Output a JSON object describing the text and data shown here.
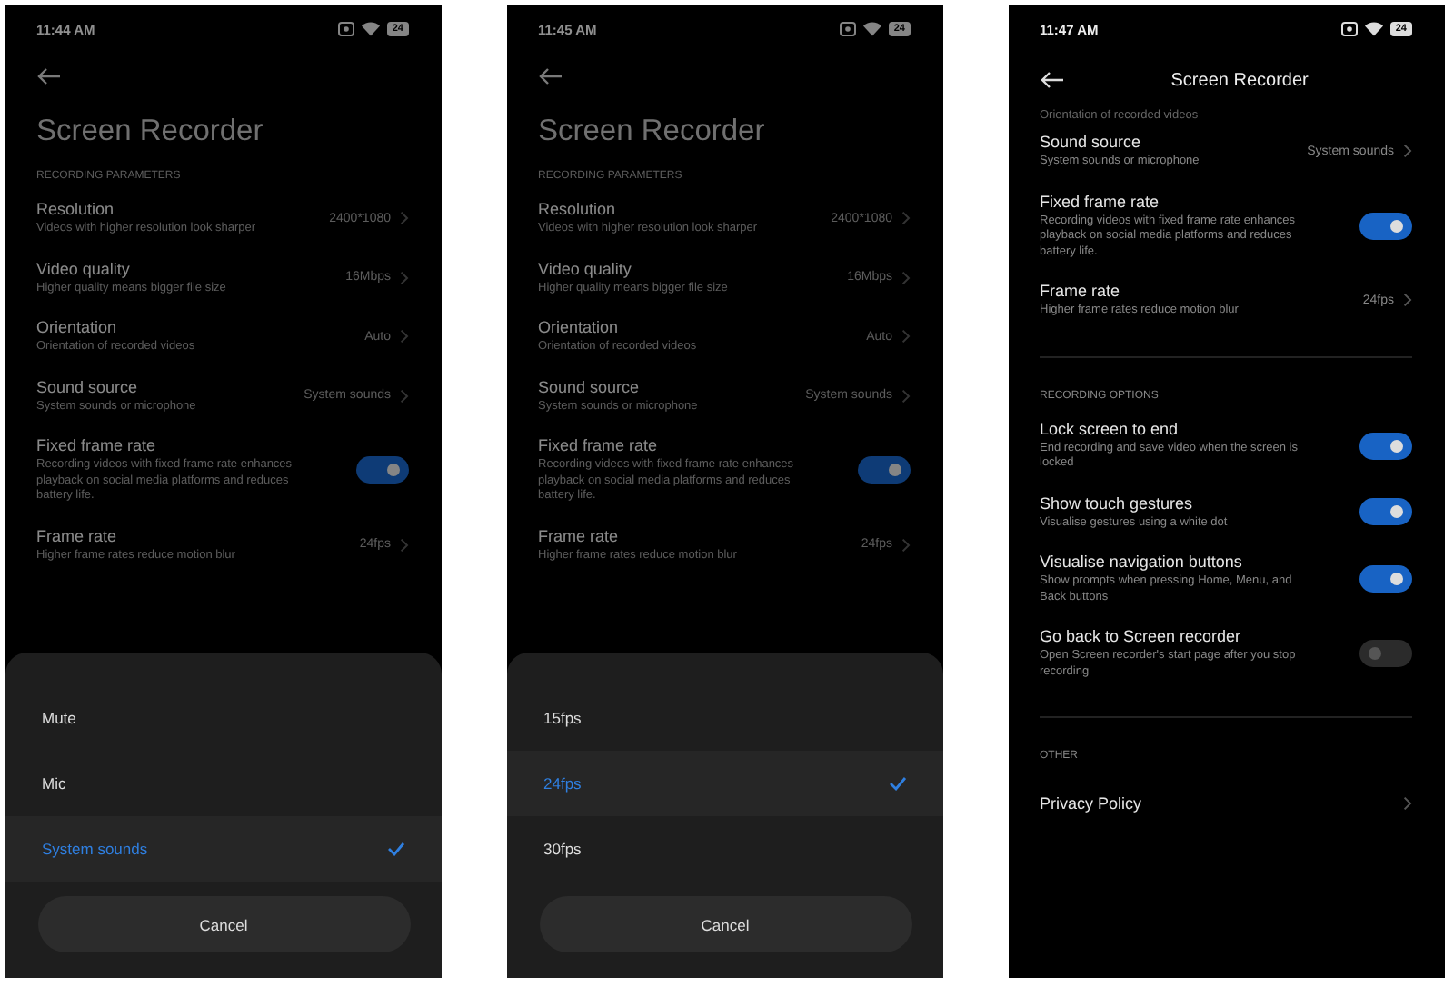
{
  "screens": [
    {
      "time": "11:44 AM",
      "battery": "24",
      "dimmed": true,
      "header": {
        "kind": "large",
        "title": "Screen Recorder"
      },
      "sections": [
        {
          "heading": "RECORDING PARAMETERS",
          "items": [
            {
              "kind": "value",
              "title": "Resolution",
              "subtitle": "Videos with higher resolution look sharper",
              "value": "2400*1080"
            },
            {
              "kind": "value",
              "title": "Video quality",
              "subtitle": "Higher quality means bigger file size",
              "value": "16Mbps"
            },
            {
              "kind": "value",
              "title": "Orientation",
              "subtitle": "Orientation of recorded videos",
              "value": "Auto"
            },
            {
              "kind": "value",
              "title": "Sound source",
              "subtitle": "System sounds or microphone",
              "value": "System sounds"
            },
            {
              "kind": "toggle",
              "title": "Fixed frame rate",
              "subtitle": "Recording videos with fixed frame rate enhances playback on social media platforms and reduces battery life.",
              "on": true
            },
            {
              "kind": "value",
              "title": "Frame rate",
              "subtitle": "Higher frame rates reduce motion blur",
              "value": "24fps"
            }
          ]
        }
      ],
      "sheet": {
        "options": [
          {
            "label": "Mute",
            "selected": false
          },
          {
            "label": "Mic",
            "selected": false
          },
          {
            "label": "System sounds",
            "selected": true
          }
        ],
        "cancel": "Cancel"
      }
    },
    {
      "time": "11:45 AM",
      "battery": "24",
      "dimmed": true,
      "header": {
        "kind": "large",
        "title": "Screen Recorder"
      },
      "sections": [
        {
          "heading": "RECORDING PARAMETERS",
          "items": [
            {
              "kind": "value",
              "title": "Resolution",
              "subtitle": "Videos with higher resolution look sharper",
              "value": "2400*1080"
            },
            {
              "kind": "value",
              "title": "Video quality",
              "subtitle": "Higher quality means bigger file size",
              "value": "16Mbps"
            },
            {
              "kind": "value",
              "title": "Orientation",
              "subtitle": "Orientation of recorded videos",
              "value": "Auto"
            },
            {
              "kind": "value",
              "title": "Sound source",
              "subtitle": "System sounds or microphone",
              "value": "System sounds"
            },
            {
              "kind": "toggle",
              "title": "Fixed frame rate",
              "subtitle": "Recording videos with fixed frame rate enhances playback on social media platforms and reduces battery life.",
              "on": true
            },
            {
              "kind": "value",
              "title": "Frame rate",
              "subtitle": "Higher frame rates reduce motion blur",
              "value": "24fps"
            }
          ]
        }
      ],
      "sheet": {
        "options": [
          {
            "label": "15fps",
            "selected": false
          },
          {
            "label": "24fps",
            "selected": true
          },
          {
            "label": "30fps",
            "selected": false
          }
        ],
        "cancel": "Cancel"
      }
    },
    {
      "time": "11:47 AM",
      "battery": "24",
      "dimmed": false,
      "header": {
        "kind": "bar",
        "title": "Screen Recorder"
      },
      "clipped_text": "Orientation of recorded videos",
      "sections": [
        {
          "items": [
            {
              "kind": "value",
              "title": "Sound source",
              "subtitle": "System sounds or microphone",
              "value": "System sounds"
            },
            {
              "kind": "toggle",
              "title": "Fixed frame rate",
              "subtitle": "Recording videos with fixed frame rate enhances playback on social media platforms and reduces battery life.",
              "on": true
            },
            {
              "kind": "value",
              "title": "Frame rate",
              "subtitle": "Higher frame rates reduce motion blur",
              "value": "24fps"
            }
          ]
        },
        {
          "heading": "RECORDING OPTIONS",
          "items": [
            {
              "kind": "toggle",
              "title": "Lock screen to end",
              "subtitle": "End recording and save video when the screen is locked",
              "on": true
            },
            {
              "kind": "toggle",
              "title": "Show touch gestures",
              "subtitle": "Visualise gestures using a white dot",
              "on": true
            },
            {
              "kind": "toggle",
              "title": "Visualise navigation buttons",
              "subtitle": "Show prompts when pressing Home, Menu, and Back buttons",
              "on": true
            },
            {
              "kind": "toggle",
              "title": "Go back to Screen recorder",
              "subtitle": "Open Screen recorder's start page after you stop recording",
              "on": false
            }
          ]
        },
        {
          "heading": "OTHER",
          "items": [
            {
              "kind": "link",
              "title": "Privacy Policy"
            }
          ]
        }
      ]
    }
  ]
}
